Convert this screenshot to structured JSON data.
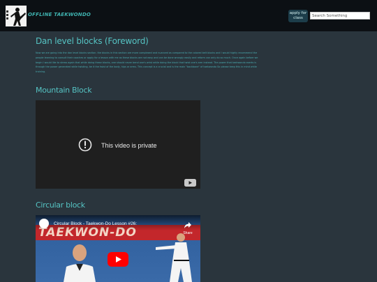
{
  "header": {
    "site_title": "OFFLINE TAEKWONDO",
    "apply_button_label": "apply for class",
    "search_placeholder": "Search Something"
  },
  "main": {
    "page_heading": "Dan level blocks (Foreword)",
    "foreword_text": "Now we are going into the dan level blocks section. the blocks in this section are more complexed and nuanced as compared to the colored belt blocks and I would highly recommend the people learning to consult their coaches or apply for a lesson with me as these blocks are not easy and can be done wrongly easily and reform can only do so much. Once again before we begin I would like to stress again that while doing these blocks, one should never bend one's wrist while doing the block that twist one's arm instead. The power that taekwondo exerts is through the power generated while twisting, be it the twist of the body, hips or arms. This concept is a crucial and is the main \"backbone\" of taekwondo So please keep this in mind while training.",
    "sections": [
      {
        "heading": "Mountain Block",
        "video_status_text": "This video is private"
      },
      {
        "heading": "Circular block",
        "video_title": "Circular Block - Taekwon-Do Lesson #26:",
        "share_label": "Share",
        "thumbnail_banner_text": "TAEKWON-DO"
      }
    ]
  },
  "colors": {
    "accent": "#55c3c3",
    "header_bg": "#0c1014",
    "page_bg": "#2a353d",
    "youtube_red": "#ff0000"
  }
}
